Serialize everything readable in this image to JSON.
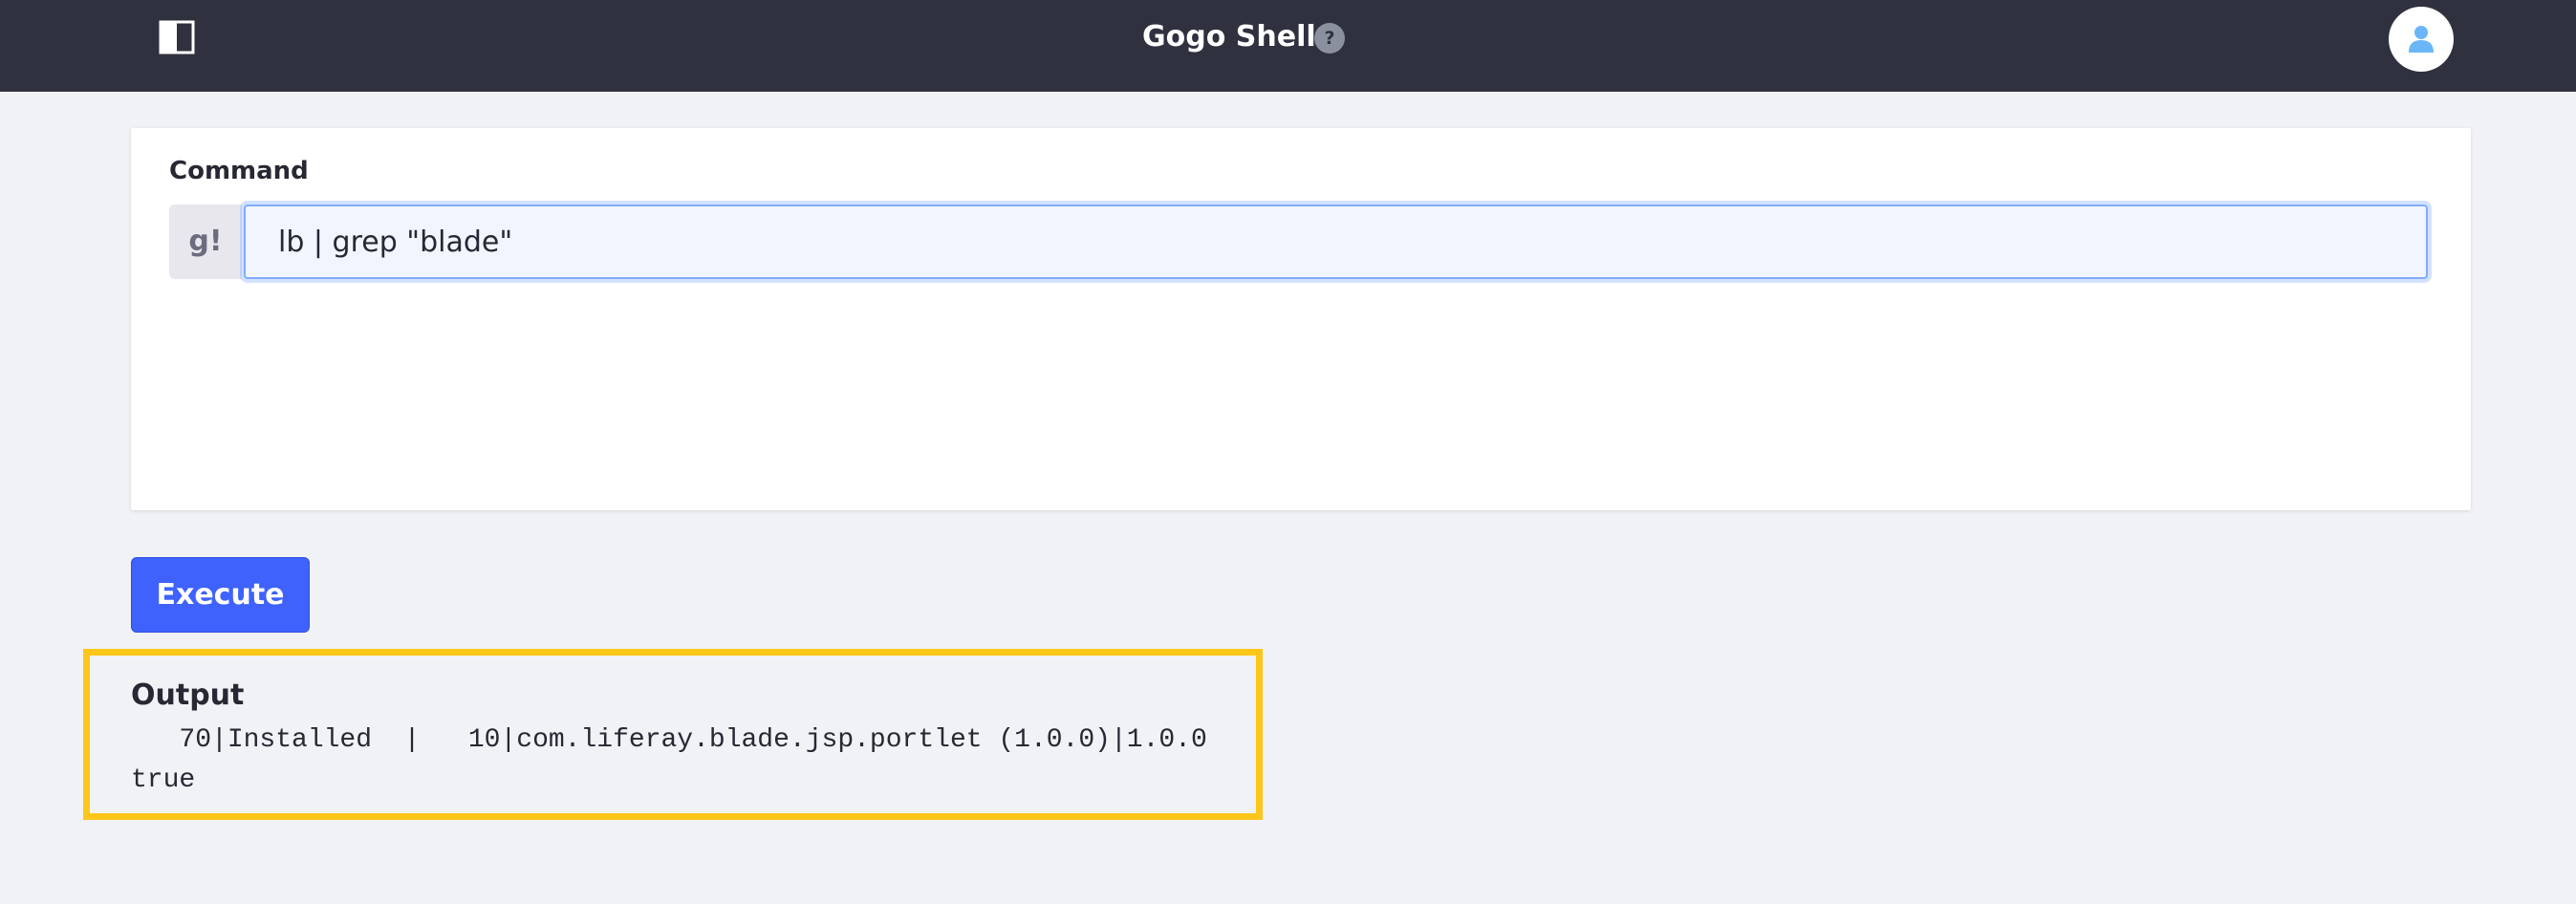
{
  "header": {
    "title": "Gogo Shell",
    "help_glyph": "?",
    "icons": {
      "panel_toggle": "panel-toggle-icon",
      "help": "help-icon",
      "avatar": "user-avatar-icon"
    },
    "colors": {
      "background": "#30313f",
      "avatar_figure": "#6ab6f7"
    }
  },
  "command": {
    "label": "Command",
    "prefix": "g!",
    "value": "lb | grep \"blade\""
  },
  "actions": {
    "execute_label": "Execute"
  },
  "output": {
    "label": "Output",
    "lines": "   70|Installed  |   10|com.liferay.blade.jsp.portlet (1.0.0)|1.0.0\ntrue",
    "highlight_color": "#ffc61a"
  },
  "colors": {
    "accent": "#3e62fb",
    "page_background": "#f1f2f5"
  }
}
